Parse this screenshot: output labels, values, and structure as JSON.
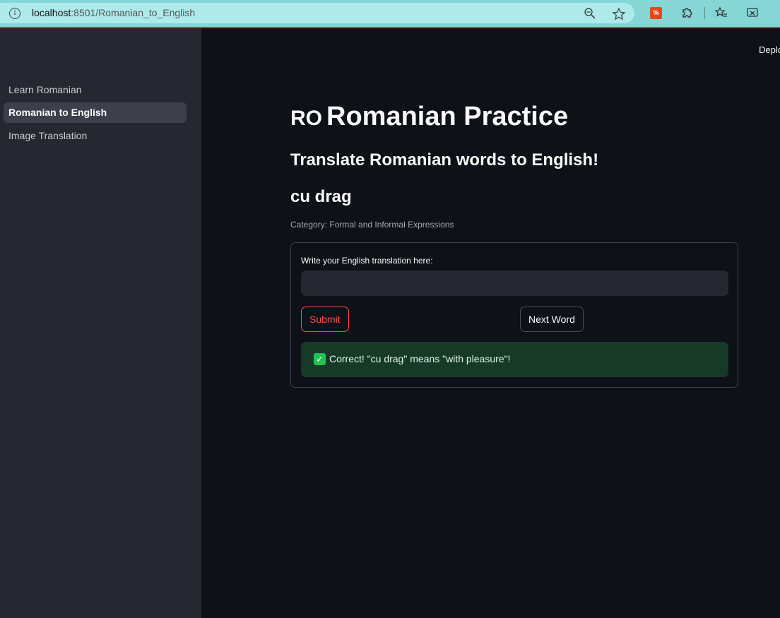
{
  "browser": {
    "url_host": "localhost",
    "url_rest": ":8501/Romanian_to_English",
    "ext_badge": "%"
  },
  "sidebar": {
    "items": [
      {
        "label": "Learn Romanian"
      },
      {
        "label": "Romanian to English",
        "active": true
      },
      {
        "label": "Image Translation"
      }
    ]
  },
  "header": {
    "deploy_label": "Deplo"
  },
  "main": {
    "flag_code": "RO",
    "title": "Romanian Practice",
    "subheader": "Translate Romanian words to English!",
    "word": "cu drag",
    "category": "Category: Formal and Informal Expressions",
    "form": {
      "input_label": "Write your English translation here:",
      "input_value": "",
      "submit_label": "Submit",
      "next_label": "Next Word"
    },
    "feedback": {
      "message": "Correct! \"cu drag\" means \"with pleasure\"!"
    }
  },
  "colors": {
    "background": "#0e1117",
    "sidebar": "#262730",
    "primary": "#ff4b4b",
    "success_bg": "#173928",
    "success_icon": "#21c354"
  }
}
